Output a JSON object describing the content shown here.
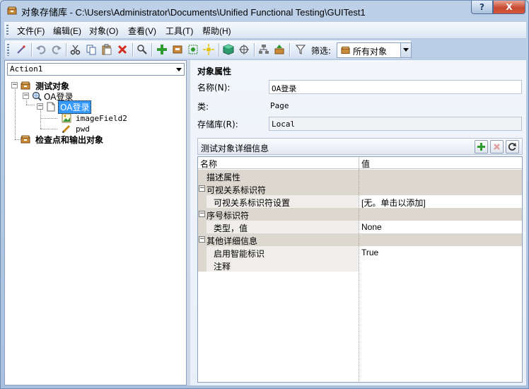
{
  "window": {
    "title": "对象存储库 - C:\\Users\\Administrator\\Documents\\Unified Functional Testing\\GUITest1",
    "help_label": "?",
    "close_label": "X"
  },
  "menu": {
    "items": [
      {
        "label": "文件(F)"
      },
      {
        "label": "编辑(E)"
      },
      {
        "label": "对象(O)"
      },
      {
        "label": "查看(V)"
      },
      {
        "label": "工具(T)"
      },
      {
        "label": "帮助(H)"
      }
    ]
  },
  "toolbar": {
    "filter_label": "筛选:",
    "filter_value": "所有对象",
    "colors": {
      "add": "#2e9a2e",
      "delete": "#d42a1f",
      "highlight": "#e8c000"
    }
  },
  "left": {
    "action_value": "Action1",
    "tree": {
      "root": "测试对象",
      "browser": "OA登录",
      "page": "OA登录",
      "field1": "imageField2",
      "field2": "pwd",
      "checkpoints": "检查点和输出对象"
    }
  },
  "props": {
    "section_title": "对象属性",
    "name_label": "名称(N):",
    "name_value": "OA登录",
    "class_label": "类:",
    "class_value": "Page",
    "repo_label": "存储库(R):",
    "repo_value": "Local"
  },
  "details": {
    "title": "测试对象详细信息",
    "col_name": "名称",
    "col_value": "值",
    "rows": [
      {
        "key": "描述属性",
        "value": ""
      },
      {
        "key": "可视关系标识符",
        "value": ""
      },
      {
        "key": "可视关系标识符设置",
        "value": "[无。单击以添加]"
      },
      {
        "key": "序号标识符",
        "value": ""
      },
      {
        "key": "类型，值",
        "value": "None"
      },
      {
        "key": "其他详细信息",
        "value": ""
      },
      {
        "key": "启用智能标识",
        "value": "True"
      },
      {
        "key": "注释",
        "value": ""
      }
    ],
    "expand_symbol": "−"
  }
}
